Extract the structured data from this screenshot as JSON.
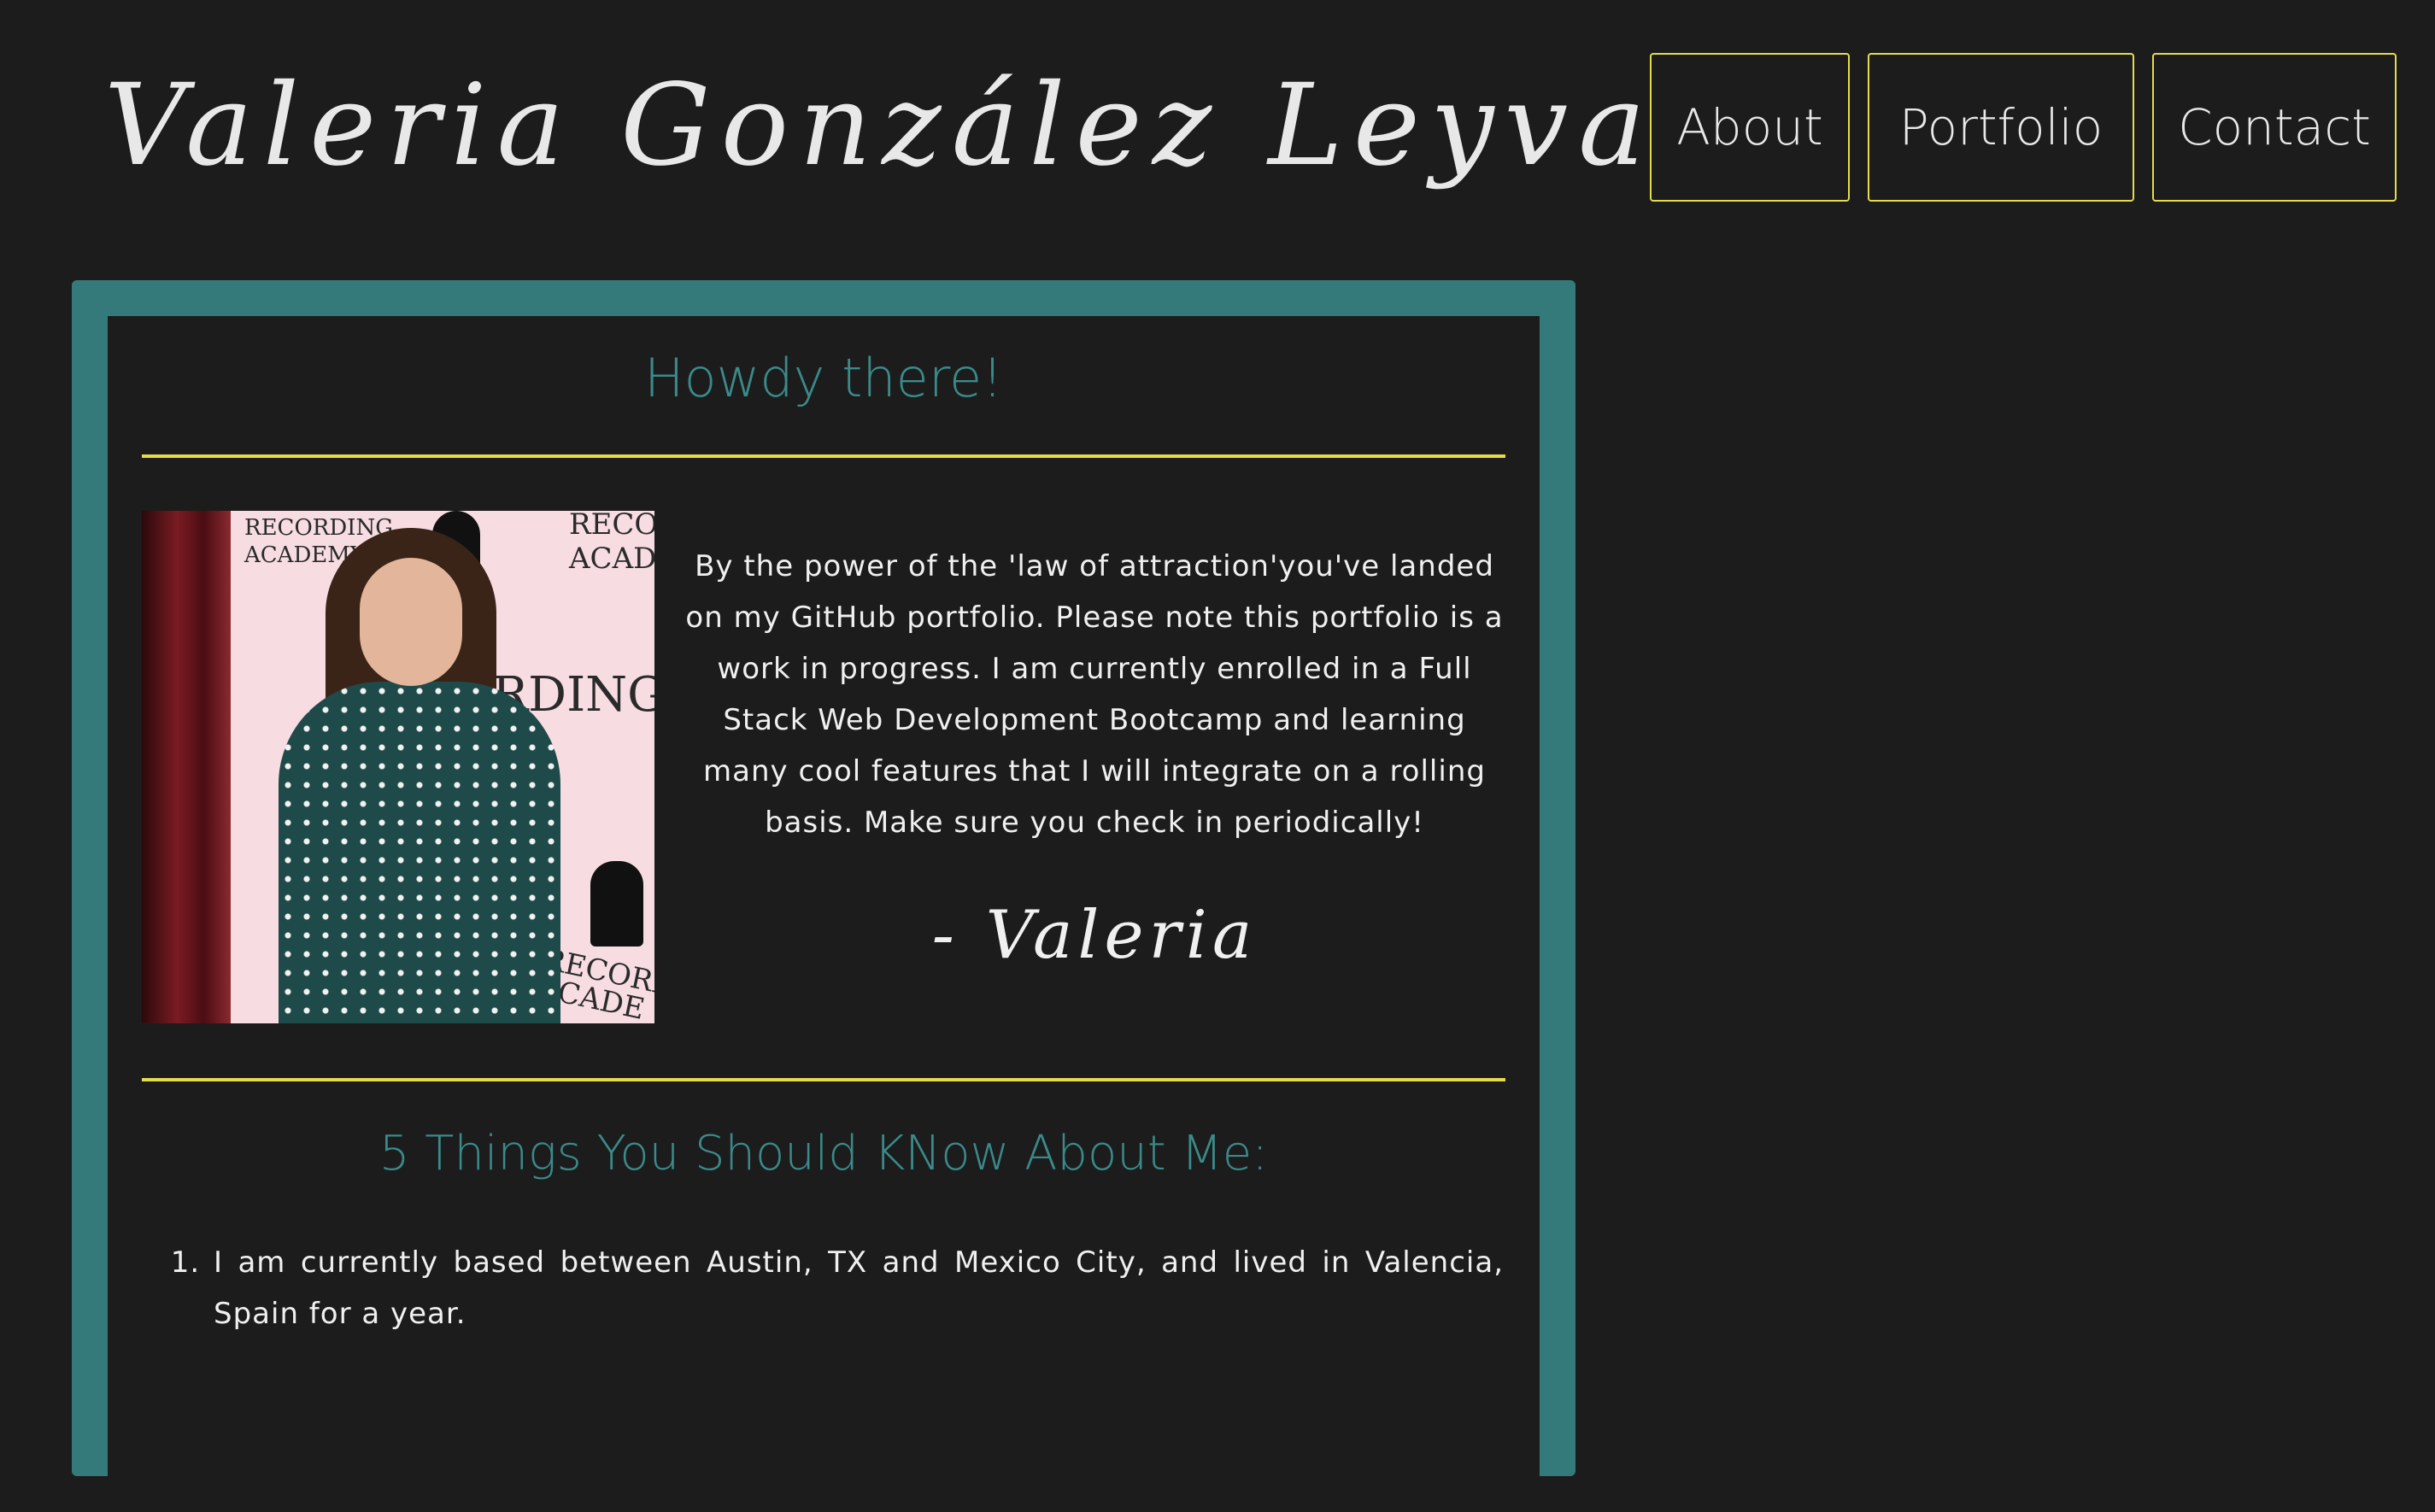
{
  "header": {
    "title": "Valeria González Leyva",
    "nav": [
      {
        "label": "About"
      },
      {
        "label": "Portfolio"
      },
      {
        "label": "Contact"
      }
    ]
  },
  "main": {
    "greeting": "Howdy there!",
    "photo": {
      "backdrop_text_1": "RECORDING\nACADEMY",
      "backdrop_text_2": "RECOR\nACADE",
      "backdrop_text_3": "RDING",
      "backdrop_text_4": "RECORDI\nACADE"
    },
    "intro": "By the power of the 'law of attraction'you've landed on my GitHub portfolio. Please note this portfolio is a work in progress. I am currently enrolled in a Full Stack Web Development Bootcamp and learning many cool features that I will integrate on a rolling basis. Make sure you check in periodically!",
    "signature": "- Valeria",
    "facts_heading": "5 Things You Should KNow About Me:",
    "facts": [
      "I am currently based between Austin, TX and Mexico City, and lived in Valencia, Spain for a year."
    ]
  },
  "colors": {
    "background": "#1c1c1c",
    "accent_teal": "#357a7a",
    "accent_yellow": "#e6dc4a",
    "text": "#f0f0f0"
  }
}
